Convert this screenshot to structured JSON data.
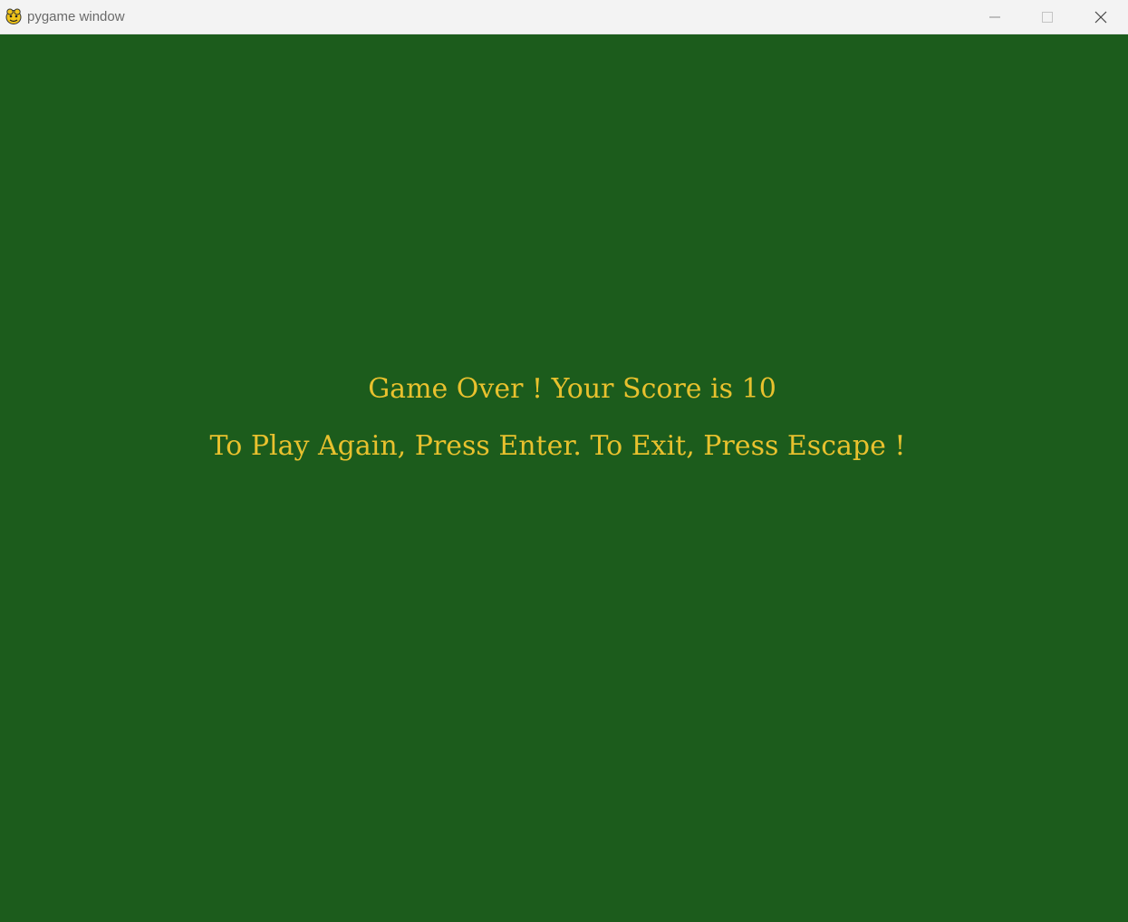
{
  "window": {
    "title": "pygame window",
    "app_icon": "pygame-snake-icon",
    "controls": {
      "minimize_icon": "minimize-icon",
      "maximize_icon": "maximize-icon",
      "close_icon": "close-icon"
    }
  },
  "game": {
    "background_color": "#1c5c1c",
    "text_color": "#e8c12e",
    "game_over_message": "Game Over ! Your Score is 10",
    "instructions": "To Play Again, Press Enter. To Exit, Press Escape !"
  }
}
